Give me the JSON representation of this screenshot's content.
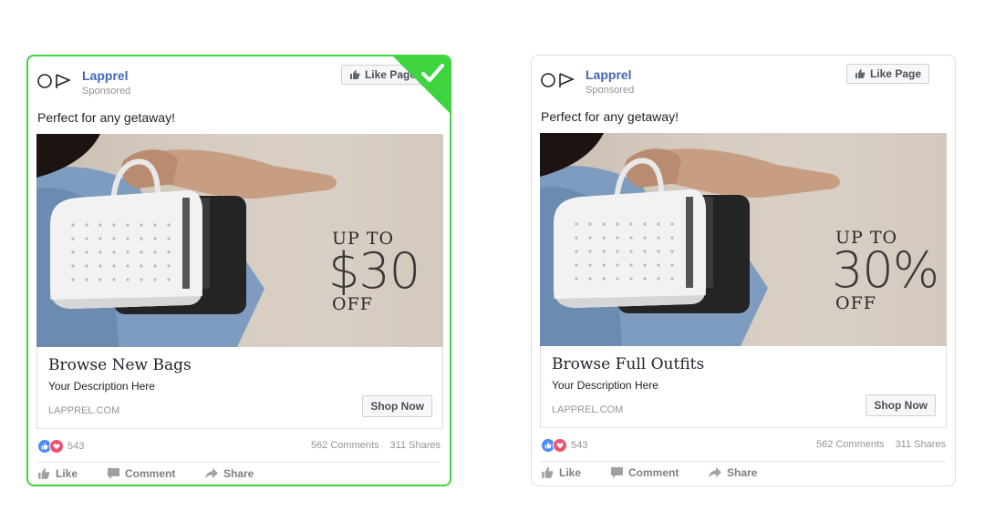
{
  "brand": {
    "winner_color": "#3fd43f",
    "fb_blue": "#4267b2"
  },
  "ads": [
    {
      "page_name": "Lapprel",
      "sponsored": "Sponsored",
      "like_page": "Like Page",
      "post_text": "Perfect for any getaway!",
      "promo": {
        "top": "UP TO",
        "big": "$30",
        "bottom": "OFF"
      },
      "headline": "Browse New Bags",
      "description": "Your Description Here",
      "domain": "LAPPREL.COM",
      "cta": "Shop Now",
      "reaction_count": "543",
      "comments": "562 Comments",
      "shares": "311 Shares",
      "actions": {
        "like": "Like",
        "comment": "Comment",
        "share": "Share"
      },
      "winner": true
    },
    {
      "page_name": "Lapprel",
      "sponsored": "Sponsored",
      "like_page": "Like Page",
      "post_text": "Perfect for any getaway!",
      "promo": {
        "top": "UP TO",
        "big": "30%",
        "bottom": "OFF"
      },
      "headline": "Browse Full Outfits",
      "description": "Your Description Here",
      "domain": "LAPPREL.COM",
      "cta": "Shop Now",
      "reaction_count": "543",
      "comments": "562 Comments",
      "shares": "311 Shares",
      "actions": {
        "like": "Like",
        "comment": "Comment",
        "share": "Share"
      },
      "winner": false
    }
  ]
}
